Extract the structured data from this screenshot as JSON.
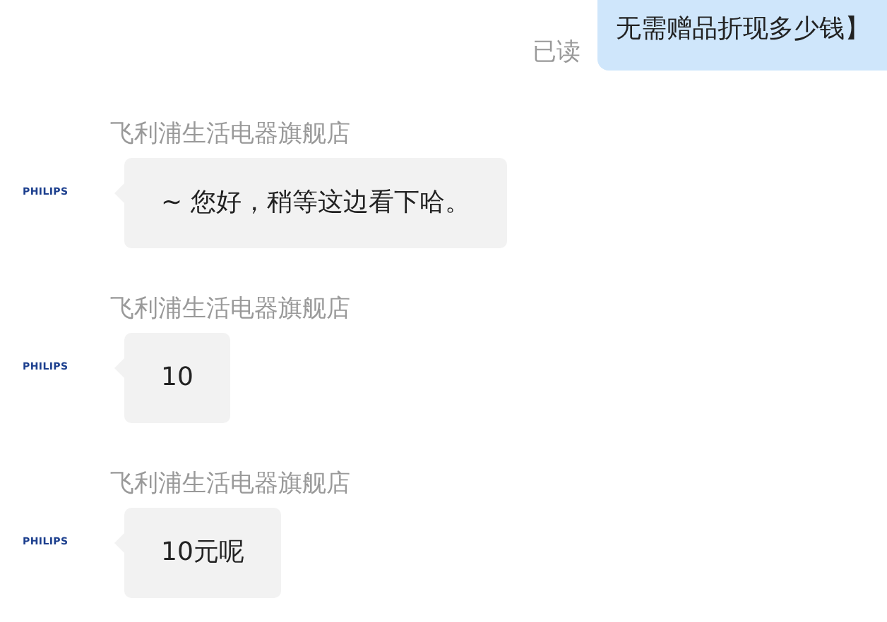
{
  "sent_message": {
    "text": "无需赠品折现多少钱】",
    "status": "已读"
  },
  "messages": [
    {
      "sender": "飞利浦生活电器旗舰店",
      "avatar": "PHILIPS",
      "text": "~ 您好，稍等这边看下哈。"
    },
    {
      "sender": "飞利浦生活电器旗舰店",
      "avatar": "PHILIPS",
      "text": "10"
    },
    {
      "sender": "飞利浦生活电器旗舰店",
      "avatar": "PHILIPS",
      "text": "10元呢"
    }
  ]
}
